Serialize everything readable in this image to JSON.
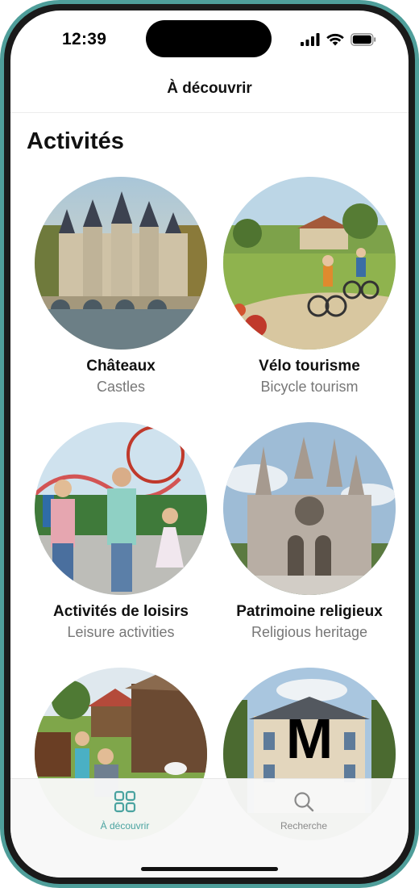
{
  "status": {
    "time": "12:39",
    "icons": [
      "signal-icon",
      "wifi-icon",
      "battery-icon"
    ]
  },
  "header": {
    "title": "À découvrir"
  },
  "section": {
    "title": "Activités"
  },
  "activities": [
    {
      "title": "Châteaux",
      "subtitle": "Castles",
      "image": "castle-image"
    },
    {
      "title": "Vélo tourisme",
      "subtitle": "Bicycle tourism",
      "image": "cycling-image"
    },
    {
      "title": "Activités de loisirs",
      "subtitle": "Leisure activities",
      "image": "family-park-image"
    },
    {
      "title": "Patrimoine religieux",
      "subtitle": "Religious heritage",
      "image": "cathedral-image"
    },
    {
      "title": "",
      "subtitle": "",
      "image": "farm-image"
    },
    {
      "title": "",
      "subtitle": "",
      "image": "manor-image",
      "overlay_letter": "M"
    }
  ],
  "tabbar": {
    "tabs": [
      {
        "label": "À découvrir",
        "icon": "grid-icon",
        "active": true
      },
      {
        "label": "Recherche",
        "icon": "search-icon",
        "active": false
      }
    ],
    "active_color": "#4aa3a0",
    "inactive_color": "#8a8a8a"
  }
}
